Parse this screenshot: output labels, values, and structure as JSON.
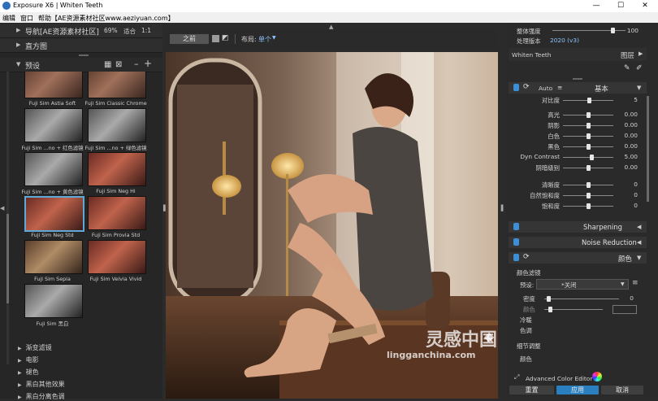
{
  "window": {
    "title": "Exposure X6 | Whiten Teeth",
    "minimize": "—",
    "maximize": "☐",
    "close": "✕"
  },
  "menu": [
    "编辑",
    "窗口",
    "帮助【AE资源素材社区www.aeziyuan.com】"
  ],
  "left": {
    "nav_label": "导航[AE资源素材社区]",
    "nav_zoom": "69%",
    "nav_fit": "适合",
    "nav_ratio": "1:1",
    "histogram_label": "直方图",
    "presets_label": "预设",
    "thumbnails": [
      {
        "caption": "Fuji Sim Astia Soft",
        "tone": "warm"
      },
      {
        "caption": "Fuji Sim Classic Chrome",
        "tone": "warm"
      },
      {
        "caption": "Fuji Sim ...no + 红色滤镜",
        "tone": "bw"
      },
      {
        "caption": "Fuji Sim ...no + 绿色滤镜",
        "tone": "bw"
      },
      {
        "caption": "Fuji Sim ...no + 黄色滤镜",
        "tone": "bw"
      },
      {
        "caption": "Fuji Sim Neg Hi",
        "tone": "red"
      },
      {
        "caption": "Fuji Sim Neg Std",
        "tone": "red"
      },
      {
        "caption": "Fuji Sim Provia Std",
        "tone": "red"
      },
      {
        "caption": "Fuji Sim Sepia",
        "tone": "sepia"
      },
      {
        "caption": "Fuji Sim Velvia Vivid",
        "tone": "red"
      },
      {
        "caption": "Fuji Sim 黑白",
        "tone": "bw"
      }
    ],
    "categories": [
      "渐变滤镜",
      "电影",
      "褪色",
      "黑白其他效果",
      "黑白分离色调"
    ]
  },
  "center": {
    "before_label": "之前",
    "layout_label": "布局:",
    "layout_value": "单个"
  },
  "right": {
    "overall_strength_label": "整体强度",
    "overall_strength_value": "100",
    "process_version_label": "处理版本",
    "process_version_value": "2020 (v3)",
    "layer_name": "Whiten Teeth",
    "layers_label": "图层",
    "basic_auto": "Auto",
    "basic_title": "基本",
    "sliders": [
      {
        "label": "对比度",
        "value": "5",
        "pos": 0.52
      },
      {
        "label": "高光",
        "value": "0.00",
        "pos": 0.5
      },
      {
        "label": "阴影",
        "value": "0.00",
        "pos": 0.5
      },
      {
        "label": "白色",
        "value": "0.00",
        "pos": 0.5
      },
      {
        "label": "黑色",
        "value": "0.00",
        "pos": 0.5
      },
      {
        "label": "Dyn Contrast",
        "value": "5.00",
        "pos": 0.56
      },
      {
        "label": "阴暗级别",
        "value": "0.00",
        "pos": 0.5
      },
      {
        "label": "清晰度",
        "value": "0",
        "pos": 0.5
      },
      {
        "label": "自然饱和度",
        "value": "0",
        "pos": 0.5
      },
      {
        "label": "饱和度",
        "value": "0",
        "pos": 0.5
      }
    ],
    "sharpening_title": "Sharpening",
    "noise_title": "Noise Reduction",
    "color_title": "颜色",
    "color_filter_label": "颜色滤镜",
    "preset_label": "预设:",
    "preset_value": "*关闭",
    "density_label": "密度",
    "density_value": "0",
    "color_label": "颜色",
    "warmth_label": "冷暖",
    "tint_label": "色调",
    "fine_tune_label": "细节调整",
    "extra_label": "颜色",
    "advanced_color_label": "Advanced Color Editor",
    "reset_label": "重置",
    "apply_label": "应用",
    "cancel_label": "取消"
  },
  "watermark": {
    "name": "灵感中国",
    "url": "lingganchina.com"
  },
  "colors": {
    "accent": "#3c8fd6",
    "panel": "#2a2a2a",
    "apply": "#2a7fc1"
  }
}
